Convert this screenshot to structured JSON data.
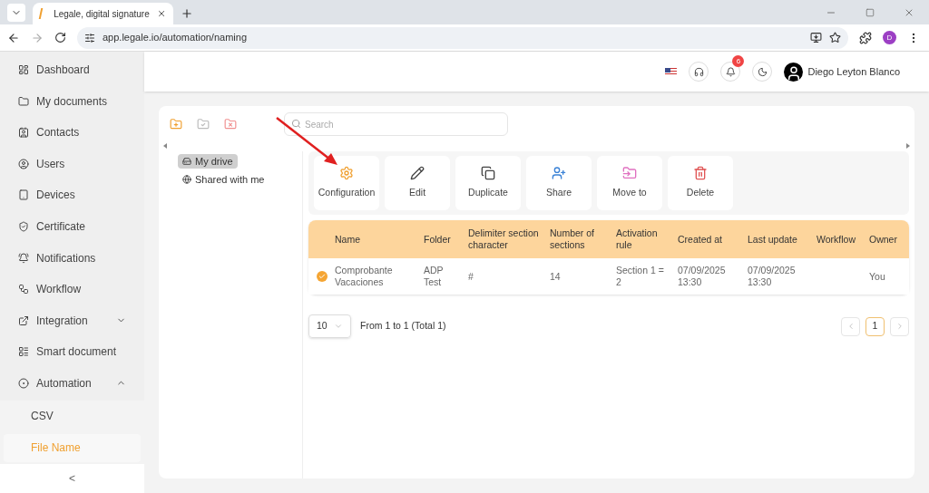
{
  "browser": {
    "tab_title": "Legale, digital signature",
    "url": "app.legale.io/automation/naming",
    "profile_initial": "D"
  },
  "sidebar": {
    "items": [
      {
        "label": "Dashboard",
        "selected": false
      },
      {
        "label": "My documents",
        "selected": false
      },
      {
        "label": "Contacts",
        "selected": false
      },
      {
        "label": "Users",
        "selected": false
      },
      {
        "label": "Devices",
        "selected": false
      },
      {
        "label": "Certificate",
        "selected": false
      },
      {
        "label": "Notifications",
        "selected": false
      },
      {
        "label": "Workflow",
        "selected": false
      },
      {
        "label": "Integration",
        "selected": false,
        "expanded": false
      },
      {
        "label": "Smart document",
        "selected": false
      },
      {
        "label": "Automation",
        "selected": false,
        "expanded": true,
        "children": [
          {
            "label": "CSV",
            "selected": false
          },
          {
            "label": "File Name",
            "selected": true
          }
        ]
      }
    ],
    "collapse": "<"
  },
  "header": {
    "notifications_count": "6",
    "user_name": "Diego Leyton Blanco"
  },
  "search": {
    "placeholder": "Search"
  },
  "tree": [
    {
      "label": "My drive",
      "selected": true
    },
    {
      "label": "Shared with me",
      "selected": false
    }
  ],
  "actions": [
    "Configuration",
    "Edit",
    "Duplicate",
    "Share",
    "Move to",
    "Delete"
  ],
  "table": {
    "columns": [
      "Name",
      "Folder",
      "Delimiter section character",
      "Number of sections",
      "Activation rule",
      "Created at",
      "Last update",
      "Workflow",
      "Owner"
    ],
    "rows": [
      {
        "checked": true,
        "cells": [
          "Comprobante Vacaciones",
          "ADP Test",
          "#",
          "14",
          "Section 1 = 2",
          "07/09/2025 13:30",
          "07/09/2025 13:30",
          "",
          "You"
        ]
      }
    ]
  },
  "pagination": {
    "page_size": "10",
    "summary": "From 1 to 1 (Total 1)",
    "pages": [
      {
        "label": "1",
        "selected": true
      }
    ]
  }
}
